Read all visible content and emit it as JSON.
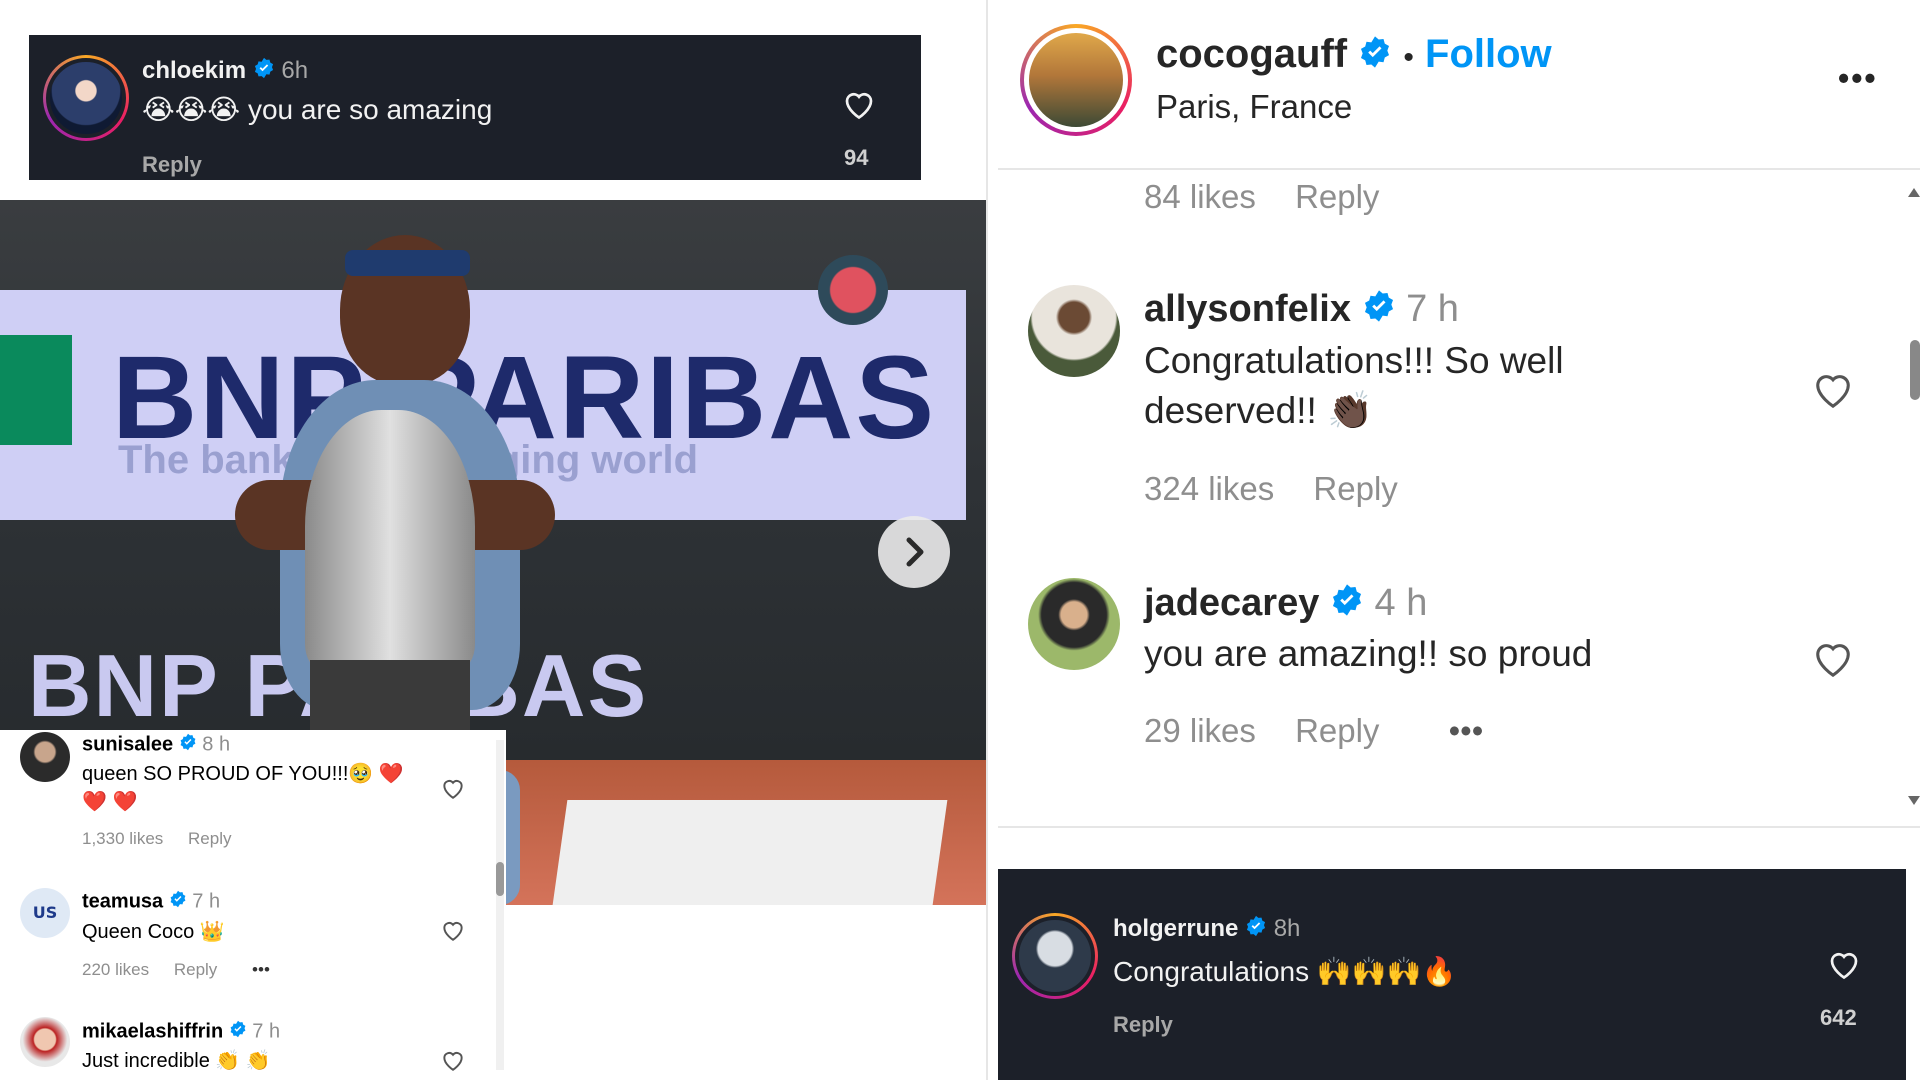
{
  "top_left_comment": {
    "username": "chloekim",
    "time": "6h",
    "emojis": "😭😭😭",
    "text": "you are so amazing",
    "reply": "Reply",
    "likes": "94"
  },
  "photo": {
    "banner_text_1": "BNP PARIBAS",
    "banner_sub": "The bank for a changing world",
    "banner_text_2": "BNP PARIBAS"
  },
  "left_comments": [
    {
      "username": "sunisalee",
      "time": "8 h",
      "text": "queen SO PROUD OF YOU!!!🥹 ❤️",
      "text2": "❤️ ❤️",
      "likes": "1,330 likes",
      "reply": "Reply"
    },
    {
      "username": "teamusa",
      "time": "7 h",
      "text": "Queen Coco 👑",
      "likes": "220 likes",
      "reply": "Reply",
      "more": "•••"
    },
    {
      "username": "mikaelashiffrin",
      "time": "7 h",
      "text": "Just incredible 👏 👏"
    }
  ],
  "post_header": {
    "username": "cocogauff",
    "separator": "•",
    "follow": "Follow",
    "location": "Paris, France",
    "more": "•••"
  },
  "right_comments": {
    "prev_likes": "84 likes",
    "prev_reply": "Reply",
    "items": [
      {
        "username": "allysonfelix",
        "time": "7 h",
        "text": "Congratulations!!! So well",
        "text2": "deserved!! 👏🏿",
        "likes": "324 likes",
        "reply": "Reply"
      },
      {
        "username": "jadecarey",
        "time": "4 h",
        "text": "you are amazing!! so proud",
        "likes": "29 likes",
        "reply": "Reply",
        "more": "•••"
      }
    ]
  },
  "bottom_right_comment": {
    "username": "holgerrune",
    "time": "8h",
    "text": "Congratulations 🙌🙌🙌🔥",
    "reply": "Reply",
    "likes": "642"
  },
  "colors": {
    "verified": "#0095f6",
    "follow": "#0095f6",
    "dark_bg": "#1c2029"
  }
}
